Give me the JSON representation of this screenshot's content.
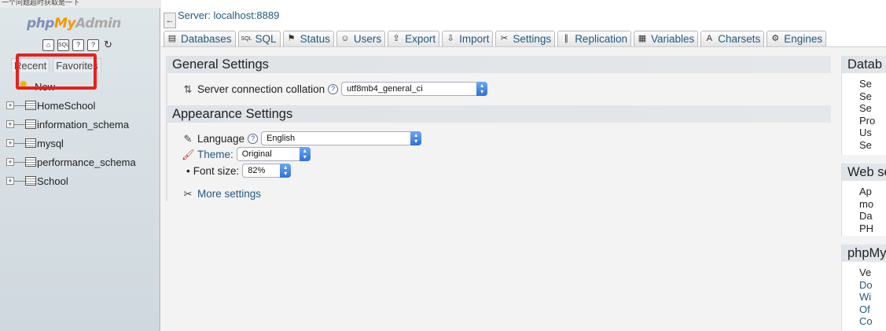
{
  "browser": {
    "tab_text": "一个问题超时获取是一下"
  },
  "nav": {
    "logo": {
      "php": "php",
      "my": "My",
      "admin": "Admin"
    },
    "icons": [
      "home-icon",
      "sql-icon",
      "query-window-icon",
      "docs-icon",
      "reload-icon"
    ],
    "tabs": [
      "Recent",
      "Favorites"
    ],
    "new_label": "New",
    "databases": [
      "HomeSchool",
      "information_schema",
      "mysql",
      "performance_schema",
      "School"
    ]
  },
  "header": {
    "collapse_symbol": "←",
    "server_crumb": "Server: localhost:8889"
  },
  "tabs": [
    {
      "label": "Databases",
      "icon": "database-icon"
    },
    {
      "label": "SQL",
      "icon": "sql-icon"
    },
    {
      "label": "Status",
      "icon": "status-icon"
    },
    {
      "label": "Users",
      "icon": "users-icon"
    },
    {
      "label": "Export",
      "icon": "export-icon"
    },
    {
      "label": "Import",
      "icon": "import-icon"
    },
    {
      "label": "Settings",
      "icon": "settings-icon"
    },
    {
      "label": "Replication",
      "icon": "replication-icon"
    },
    {
      "label": "Variables",
      "icon": "variables-icon"
    },
    {
      "label": "Charsets",
      "icon": "charsets-icon"
    },
    {
      "label": "Engines",
      "icon": "engines-icon"
    }
  ],
  "general": {
    "title": "General Settings",
    "collation_label": "Server connection collation",
    "collation_value": "utf8mb4_general_ci"
  },
  "appearance": {
    "title": "Appearance Settings",
    "language_label": "Language",
    "language_value": "English",
    "theme_label": "Theme:",
    "theme_value": "Original",
    "fontsize_label": "Font size:",
    "fontsize_value": "82%",
    "more_settings": "More settings"
  },
  "right": {
    "db_server": {
      "title": "Datab",
      "items": [
        "Se",
        "Se",
        "Se",
        "Pro",
        "Us",
        "Se"
      ]
    },
    "web_server": {
      "title": "Web se",
      "items": [
        "Ap",
        "mo",
        "Da",
        "PH"
      ]
    },
    "pma": {
      "title": "phpMy",
      "items": [
        "Ve",
        "Do",
        "Wi",
        "Of",
        "Co"
      ]
    }
  },
  "colors": {
    "link": "#235a81",
    "highlight_box": "#e8201c"
  }
}
